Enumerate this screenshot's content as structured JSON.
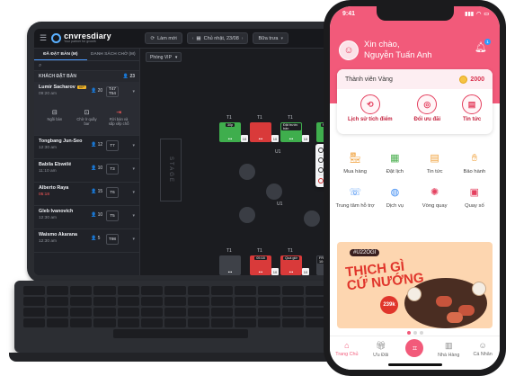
{
  "tablet": {
    "header": {
      "menu_icon": "menu-icon",
      "logo_name": "cnvresdiary",
      "logo_tagline": "Your partner for growth",
      "refresh_label": "Làm mới",
      "date_label": "Chủ nhật, 23/08",
      "shift_label": "Bữa trưa"
    },
    "tabs": [
      "ĐÃ ĐẶT BÀN (M)",
      "DANH SÁCH CHỜ (M)"
    ],
    "section": {
      "title": "KHÁCH ĐẶT BÀN",
      "count": "23"
    },
    "reservations": [
      {
        "name": "Lumir Sacharov",
        "vip": "VIP",
        "time": "09:20 am",
        "guests": "20",
        "table": "T47 T54",
        "expanded": true
      },
      {
        "name": "Tongbang Jun-Seo",
        "time": "12:30 am",
        "time_red": false,
        "guests": "12",
        "table": "T7"
      },
      {
        "name": "Babila Ebwélé",
        "time": "11:10 am",
        "time_red": false,
        "guests": "10",
        "table": "T3"
      },
      {
        "name": "Alberto Raya",
        "time": "05:18",
        "time_red": true,
        "guests": "15",
        "table": "T6"
      },
      {
        "name": "Gleb Ivanovich",
        "time": "12:30 am",
        "time_red": false,
        "guests": "10",
        "table": "T5"
      },
      {
        "name": "Waismo Akarana",
        "time": "12:30 am",
        "time_red": false,
        "guests": "5",
        "table": "T98"
      }
    ],
    "row_actions": [
      "Ngồi bàn",
      "Chờ ở quầy bar",
      "Rời bàn và sắp xếp chỗ"
    ],
    "floor": {
      "room_select": "Phòng VIP",
      "stage_label": "STAGE",
      "tables_top": [
        {
          "label": "T1",
          "status": "green",
          "sub": "30p",
          "count": "10"
        },
        {
          "label": "T1",
          "status": "red",
          "sub": "",
          "count": "10"
        },
        {
          "label": "T1",
          "status": "green",
          "sub": "Đặt trước bàn",
          "count": "10"
        },
        {
          "label": "T1",
          "status": "green",
          "sub": "FREE",
          "count": "10"
        },
        {
          "label": "T1",
          "status": "green",
          "sub": "",
          "count": ""
        }
      ],
      "round_labels": [
        "U1",
        "U1"
      ],
      "tables_bottom": [
        {
          "label": "T1",
          "status": "gray",
          "sub": "",
          "count": ""
        },
        {
          "label": "T1",
          "status": "red",
          "sub": "05:18",
          "count": "10"
        },
        {
          "label": "T1",
          "status": "red",
          "sub": "Quá giờ",
          "count": "10"
        },
        {
          "label": "T1",
          "status": "gray",
          "sub": "FREE 10:20 am",
          "count": "10"
        },
        {
          "label": "T1",
          "status": "green",
          "sub": "",
          "count": ""
        }
      ],
      "time_popup": [
        "11:00 am",
        "01:00 pm",
        "01:30 pm",
        "2:30 pm đã đến"
      ],
      "table_menu": [
        "Khóa bàn",
        "Hủy bàn"
      ]
    }
  },
  "phone": {
    "status_time": "9:41",
    "greeting_line1": "Xin chào,",
    "greeting_line2": "Nguyễn Tuấn Anh",
    "notification_count": "1",
    "membership": "Thành viên Vàng",
    "points": "2000",
    "quick_actions": [
      "Lịch sử tích điểm",
      "Đổi ưu đãi",
      "Tin tức"
    ],
    "grid": [
      {
        "label": "Mua hàng",
        "icon": "shop-icon",
        "color": "#f0a03a"
      },
      {
        "label": "Đặt lịch",
        "icon": "calendar-icon",
        "color": "#4caf50"
      },
      {
        "label": "Tin tức",
        "icon": "news-icon",
        "color": "#f0a03a"
      },
      {
        "label": "Bảo hành",
        "icon": "warranty-icon",
        "color": "#f0a03a"
      },
      {
        "label": "Trung tâm hỗ trợ",
        "icon": "support-icon",
        "color": "#3d8bf2"
      },
      {
        "label": "Dịch vụ",
        "icon": "globe-icon",
        "color": "#3d8bf2"
      },
      {
        "label": "Vòng quay",
        "icon": "wheel-icon",
        "color": "#e4405f"
      },
      {
        "label": "Quay số",
        "icon": "slot-icon",
        "color": "#e4405f"
      }
    ],
    "banner": {
      "tag": "#U22OGI",
      "headline_1": "THỊCH GÌ",
      "headline_2": "CỨ NƯỚNG",
      "price": "239k"
    },
    "nav": [
      {
        "label": "Trang Chủ",
        "icon": "home-icon",
        "active": true
      },
      {
        "label": "Ưu Đãi",
        "icon": "gift-icon",
        "active": false
      },
      {
        "label": "",
        "icon": "scan-icon",
        "active": false
      },
      {
        "label": "Nhà Hàng",
        "icon": "store-icon",
        "active": false
      },
      {
        "label": "Cá Nhân",
        "icon": "user-icon",
        "active": false
      }
    ]
  }
}
